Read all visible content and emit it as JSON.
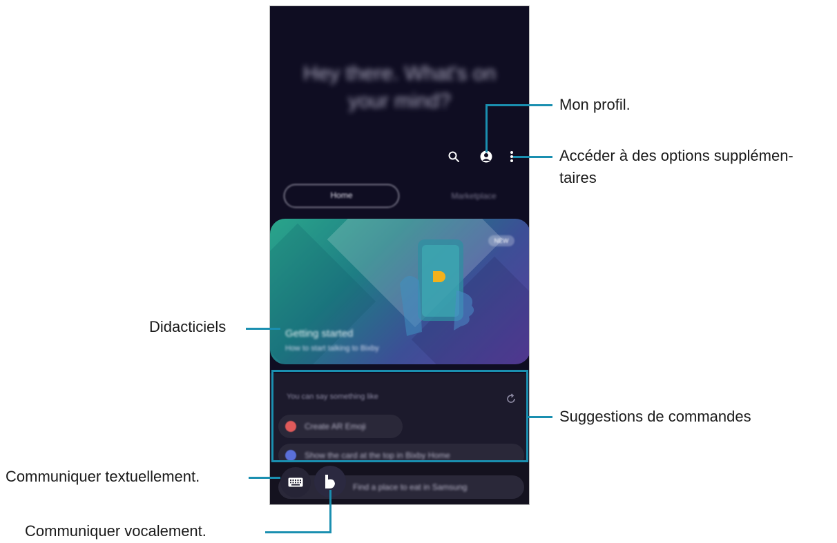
{
  "screen": {
    "greeting": "Hey there. What's on your mind?",
    "tabs": {
      "home": "Home",
      "marketplace": "Marketplace"
    },
    "tutorial": {
      "title": "Getting started",
      "subtitle": "How to start talking to Bixby",
      "badge": "NEW"
    },
    "suggestions": {
      "heading": "You can say something like",
      "items": [
        {
          "text": "Create AR Emoji",
          "icon_color": "#e05a5a"
        },
        {
          "text": "Show the card at the top in Bixby Home",
          "icon_color": "#5a6fd8"
        },
        {
          "text": "Find a place to eat in Samsung",
          "icon_color": "#6b5ec0"
        }
      ]
    },
    "icons": [
      "search-icon",
      "profile-icon",
      "more-options-icon",
      "refresh-icon",
      "keyboard-icon",
      "bixby-icon"
    ]
  },
  "callouts": {
    "profile": "Mon profil.",
    "more_options_line1": "Accéder à des options supplémen-",
    "more_options_line2": "taires",
    "tutorials": "Didacticiels",
    "suggestions": "Suggestions de commandes",
    "text_input": "Communiquer textuellement.",
    "voice_input": "Communiquer vocalement."
  },
  "colors": {
    "callout_line": "#1a8fb0",
    "background_dark": "#0f0d22",
    "bixby_accent": "#f2b11c"
  }
}
